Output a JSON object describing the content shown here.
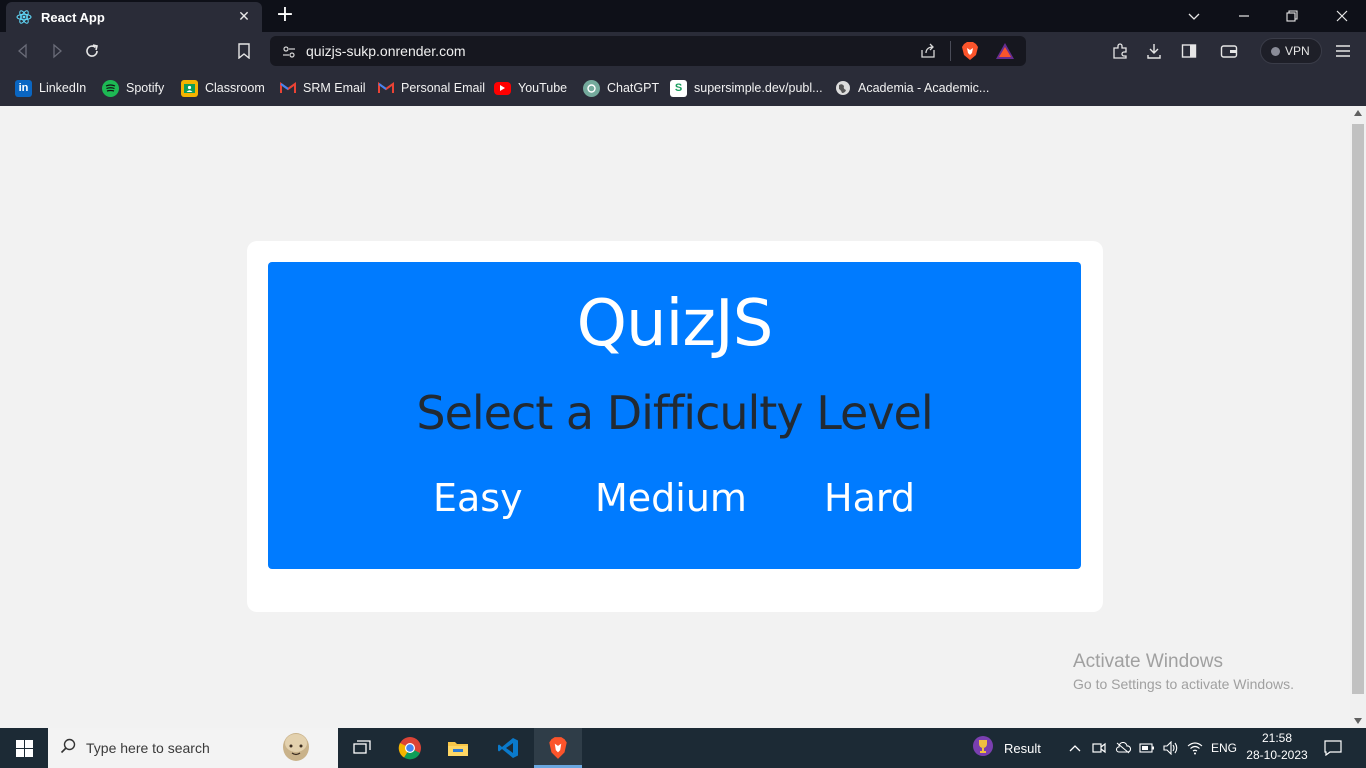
{
  "browser": {
    "tab": {
      "title": "React App",
      "close_label": "✕"
    },
    "new_tab_label": "+",
    "url": "quizjs-sukp.onrender.com",
    "vpn_label": "VPN",
    "bookmarks": [
      {
        "label": "LinkedIn",
        "icon": "linkedin-icon",
        "color": "#0a66c2"
      },
      {
        "label": "Spotify",
        "icon": "spotify-icon",
        "color": "#1db954"
      },
      {
        "label": "Classroom",
        "icon": "classroom-icon",
        "color": "#f4b400"
      },
      {
        "label": "SRM Email",
        "icon": "gmail-icon",
        "color": "#ea4335"
      },
      {
        "label": "Personal Email",
        "icon": "gmail-icon",
        "color": "#ea4335"
      },
      {
        "label": "YouTube",
        "icon": "youtube-icon",
        "color": "#ff0000"
      },
      {
        "label": "ChatGPT",
        "icon": "chatgpt-icon",
        "color": "#74aa9c"
      },
      {
        "label": "supersimple.dev/publ...",
        "icon": "supersimple-icon",
        "color": "#1a9e5f"
      },
      {
        "label": "Academia - Academic...",
        "icon": "globe-icon",
        "color": "#dcdcdc"
      }
    ]
  },
  "app": {
    "title": "QuizJS",
    "subtitle": "Select a Difficulty Level",
    "levels": [
      "Easy",
      "Medium",
      "Hard"
    ],
    "colors": {
      "panel": "#007bff",
      "card": "#ffffff",
      "subtitle": "#222a33",
      "page_bg": "#f2f2f2"
    }
  },
  "watermark": {
    "line1": "Activate Windows",
    "line2": "Go to Settings to activate Windows."
  },
  "taskbar": {
    "search_placeholder": "Type here to search",
    "result_label": "Result",
    "language": "ENG",
    "time": "21:58",
    "date": "28-10-2023"
  }
}
